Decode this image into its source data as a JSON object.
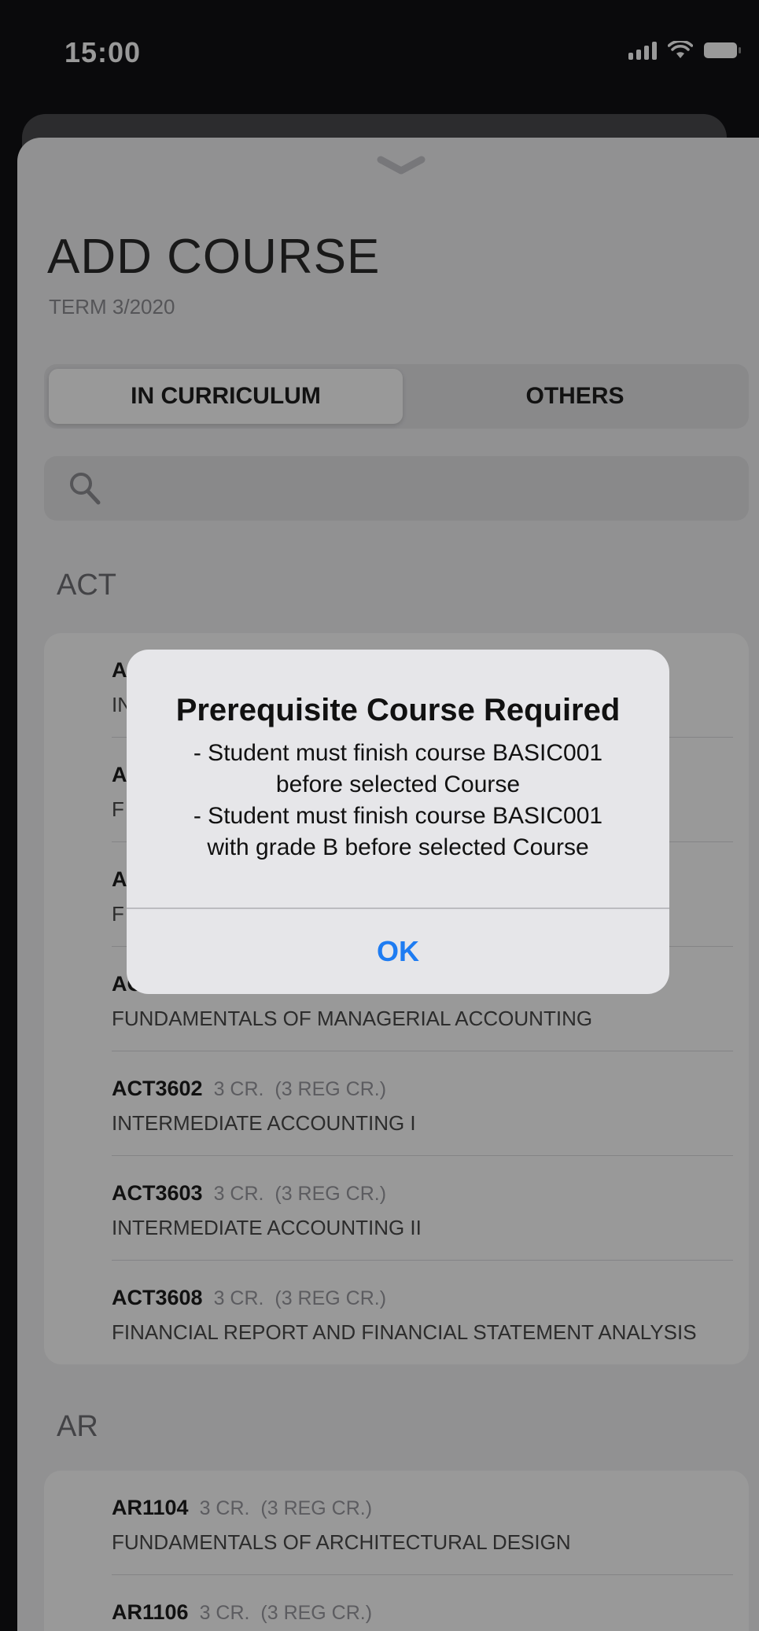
{
  "status_bar": {
    "time": "15:00"
  },
  "header": {
    "title": "ADD COURSE",
    "subtitle": "TERM 3/2020"
  },
  "segmented": {
    "tabs": [
      "IN CURRICULUM",
      "OTHERS"
    ],
    "selected": "IN CURRICULUM"
  },
  "search": {
    "placeholder": ""
  },
  "sections": [
    {
      "label": "ACT",
      "courses": [
        {
          "code": "A",
          "credits": "",
          "reg_credits": "",
          "name": "IN"
        },
        {
          "code": "A",
          "credits": "",
          "reg_credits": "",
          "name": "F"
        },
        {
          "code": "A",
          "credits": "",
          "reg_credits": "",
          "name": "F"
        },
        {
          "code": "AC",
          "credits": "",
          "reg_credits": "",
          "name": "FUNDAMENTALS OF MANAGERIAL ACCOUNTING"
        },
        {
          "code": "ACT3602",
          "credits": "3 CR.",
          "reg_credits": "(3 REG CR.)",
          "name": "INTERMEDIATE ACCOUNTING I"
        },
        {
          "code": "ACT3603",
          "credits": "3 CR.",
          "reg_credits": "(3 REG CR.)",
          "name": "INTERMEDIATE ACCOUNTING II"
        },
        {
          "code": "ACT3608",
          "credits": "3 CR.",
          "reg_credits": "(3 REG CR.)",
          "name": "FINANCIAL REPORT AND FINANCIAL STATEMENT ANALYSIS"
        }
      ]
    },
    {
      "label": "AR",
      "courses": [
        {
          "code": "AR1104",
          "credits": "3 CR.",
          "reg_credits": "(3 REG CR.)",
          "name": "FUNDAMENTALS OF ARCHITECTURAL DESIGN"
        },
        {
          "code": "AR1106",
          "credits": "3 CR.",
          "reg_credits": "(3 REG CR.)",
          "name": ""
        }
      ]
    }
  ],
  "alert": {
    "title": "Prerequisite Course Required",
    "message": "- Student must finish course BASIC001\nbefore selected Course\n- Student must finish course BASIC001\nwith grade B before selected Course",
    "button": "OK"
  },
  "colors": {
    "accent": "#1e7cf2",
    "overlay": "rgba(0,0,0,0.4)"
  },
  "icons": {
    "search": "search-icon",
    "grabber": "chevron-down-icon",
    "signal": "signal-icon",
    "wifi": "wifi-icon",
    "battery": "battery-icon"
  }
}
